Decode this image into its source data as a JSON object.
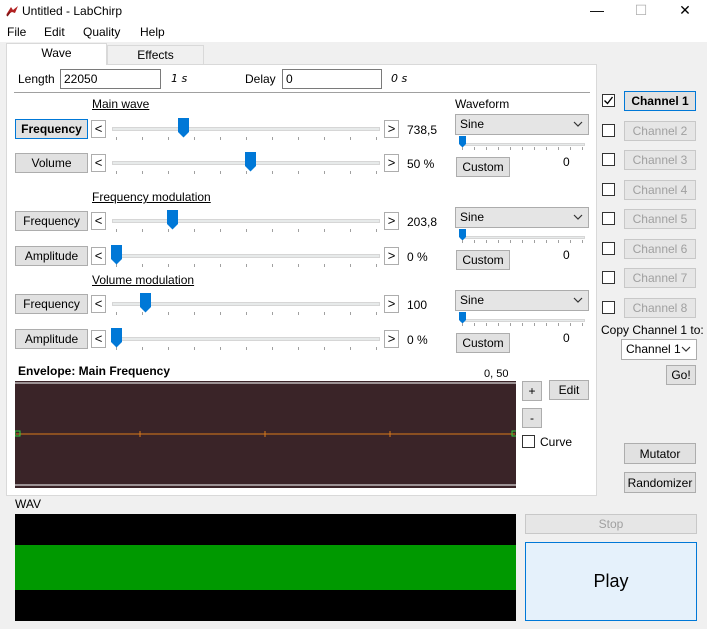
{
  "window": {
    "title": "Untitled - LabChirp",
    "minimize": "—",
    "maximize": "☐",
    "close": "✕"
  },
  "menu": [
    "File",
    "Edit",
    "Quality",
    "Help"
  ],
  "tabs": [
    "Wave",
    "Effects"
  ],
  "length": {
    "label": "Length",
    "value": "22050",
    "unit": "1 s"
  },
  "delay": {
    "label": "Delay",
    "value": "0",
    "unit": "0 s"
  },
  "sections": {
    "main_wave": "Main wave",
    "freq_mod": "Frequency modulation",
    "vol_mod": "Volume modulation",
    "waveform": "Waveform"
  },
  "sliders": {
    "main_freq": {
      "label": "Frequency",
      "value": "738,5",
      "level": 0.25
    },
    "main_vol": {
      "label": "Volume",
      "value": "50 %",
      "level": 0.5
    },
    "fm_freq": {
      "label": "Frequency",
      "value": "203,8",
      "level": 0.21
    },
    "fm_amp": {
      "label": "Amplitude",
      "value": "0 %",
      "level": 0.0
    },
    "vm_freq": {
      "label": "Frequency",
      "value": "100",
      "level": 0.11
    },
    "vm_amp": {
      "label": "Amplitude",
      "value": "0 %",
      "level": 0.0
    }
  },
  "waveforms": [
    {
      "selected": "Sine",
      "value": "0",
      "custom": "Custom"
    },
    {
      "selected": "Sine",
      "value": "0",
      "custom": "Custom"
    },
    {
      "selected": "Sine",
      "value": "0",
      "custom": "Custom"
    }
  ],
  "envelope": {
    "title": "Envelope: Main Frequency",
    "coords": "0, 50",
    "plus": "+",
    "minus": "-",
    "edit": "Edit",
    "curve": "Curve",
    "line_color": "#d97a1a",
    "bg_color": "#3a2428"
  },
  "wav": {
    "label": "WAV",
    "wave_color": "#009900"
  },
  "channels": [
    {
      "label": "Channel 1",
      "checked": true
    },
    {
      "label": "Channel 2",
      "checked": false
    },
    {
      "label": "Channel 3",
      "checked": false
    },
    {
      "label": "Channel 4",
      "checked": false
    },
    {
      "label": "Channel 5",
      "checked": false
    },
    {
      "label": "Channel 6",
      "checked": false
    },
    {
      "label": "Channel 7",
      "checked": false
    },
    {
      "label": "Channel 8",
      "checked": false
    }
  ],
  "copy": {
    "label": "Copy Channel 1 to:",
    "target": "Channel 1",
    "go": "Go!"
  },
  "mutator": "Mutator",
  "randomizer": "Randomizer",
  "stop": "Stop",
  "play": "Play",
  "icons": {
    "app": "labchirp-bird-icon"
  }
}
